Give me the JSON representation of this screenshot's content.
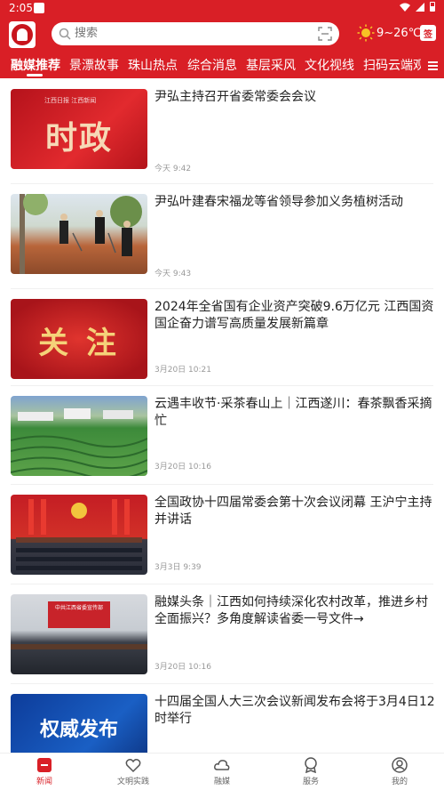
{
  "status": {
    "time": "2:05"
  },
  "header": {
    "search_placeholder": "搜索",
    "weather": "9~26℃",
    "sign_label": "签"
  },
  "tabs": [
    {
      "label": "融媒推荐",
      "active": true
    },
    {
      "label": "景漂故事"
    },
    {
      "label": "珠山热点"
    },
    {
      "label": "综合消息"
    },
    {
      "label": "基层采风"
    },
    {
      "label": "文化视线"
    },
    {
      "label": "扫码云端观"
    }
  ],
  "news": [
    {
      "title": "尹弘主持召开省委常委会会议",
      "time": "今天 9:42",
      "thumb_text": "时政",
      "thumb_sub": "江西日报  江西新闻"
    },
    {
      "title": "尹弘叶建春宋福龙等省领导参加义务植树活动",
      "time": "今天 9:43"
    },
    {
      "title": "2024年全省国有企业资产突破9.6万亿元 江西国资国企奋力谱写高质量发展新篇章",
      "time": "3月20日 10:21",
      "thumb_text": "关 注"
    },
    {
      "title": "云遇丰收节·采茶春山上｜江西遂川：春茶飘香采摘忙",
      "time": "3月20日 10:16"
    },
    {
      "title": "全国政协十四届常委会第十次会议闭幕 王沪宁主持并讲话",
      "time": "3月3日 9:39"
    },
    {
      "title": "融媒头条｜江西如何持续深化农村改革，推进乡村全面振兴？多角度解读省委一号文件→",
      "time": "3月20日 10:16",
      "thumb_text": "中共江西省委宣传部"
    },
    {
      "title": "十四届全国人大三次会议新闻发布会将于3月4日12时举行",
      "time": "",
      "thumb_text": "权威发布"
    }
  ],
  "bottom_nav": [
    {
      "label": "新闻",
      "active": true
    },
    {
      "label": "文明实践"
    },
    {
      "label": "融媒"
    },
    {
      "label": "服务"
    },
    {
      "label": "我的"
    }
  ],
  "colors": {
    "brand": "#d91f26"
  }
}
